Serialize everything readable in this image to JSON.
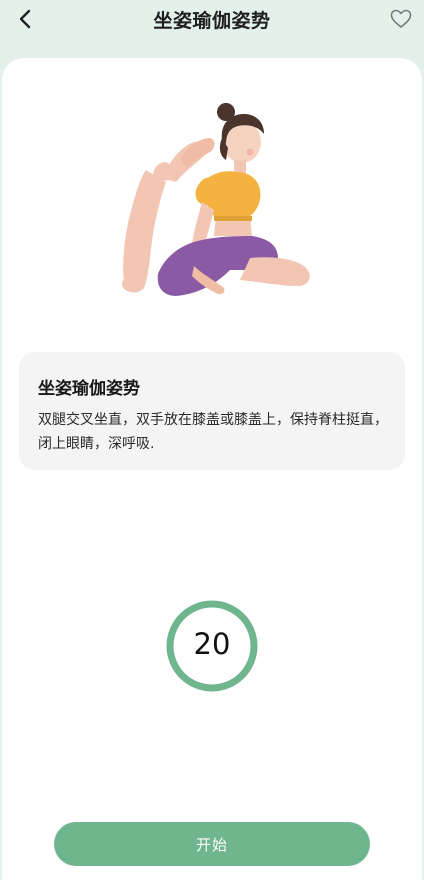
{
  "header": {
    "title": "坐姿瑜伽姿势",
    "back_icon": "chevron-left-icon",
    "favorite_icon": "heart-outline-icon"
  },
  "description": {
    "title": "坐姿瑜伽姿势",
    "text": "双腿交叉坐直，双手放在膝盖或膝盖上，保持脊柱挺直，闭上眼睛，深呼吸."
  },
  "timer": {
    "value": "20"
  },
  "actions": {
    "start_label": "开始"
  },
  "colors": {
    "accent": "#6fb58e",
    "background": "#e3f1ea"
  }
}
